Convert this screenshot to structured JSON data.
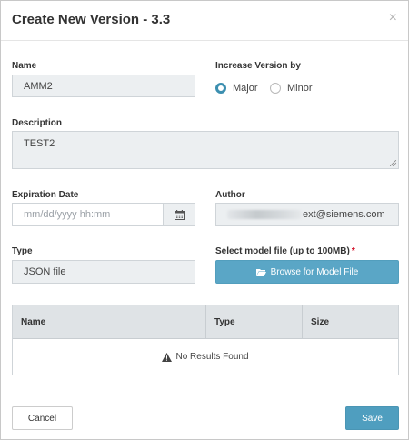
{
  "modal": {
    "title": "Create New Version - 3.3",
    "close": "×"
  },
  "fields": {
    "name": {
      "label": "Name",
      "value": "AMM2"
    },
    "increase_version": {
      "label": "Increase Version by",
      "options": [
        {
          "label": "Major",
          "checked": true
        },
        {
          "label": "Minor",
          "checked": false
        }
      ]
    },
    "description": {
      "label": "Description",
      "value": "TEST2"
    },
    "expiration_date": {
      "label": "Expiration Date",
      "placeholder": "mm/dd/yyyy hh:mm"
    },
    "author": {
      "label": "Author",
      "value_suffix": "ext@siemens.com"
    },
    "type": {
      "label": "Type",
      "value": "JSON file"
    },
    "model_file": {
      "label": "Select model file (up to 100MB)",
      "required_mark": "*",
      "button_label": "Browse for Model File"
    }
  },
  "table": {
    "columns": [
      "Name",
      "Type",
      "Size"
    ],
    "empty_text": "No Results Found"
  },
  "footer": {
    "cancel_label": "Cancel",
    "save_label": "Save"
  },
  "colors": {
    "primary": "#4f9ebf",
    "field_bg": "#eceff1",
    "required": "#d0021b"
  }
}
